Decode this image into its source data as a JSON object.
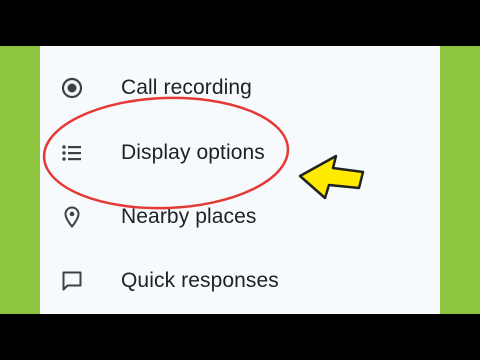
{
  "menu": {
    "items": [
      {
        "label": "Call recording",
        "icon": "radio-target-icon"
      },
      {
        "label": "Display options",
        "icon": "list-icon"
      },
      {
        "label": "Nearby places",
        "icon": "location-pin-icon"
      },
      {
        "label": "Quick responses",
        "icon": "chat-bubble-icon"
      }
    ]
  },
  "colors": {
    "frame_green": "#8ec63f",
    "panel_bg": "#f7fafc",
    "text": "#202124",
    "highlight_circle": "#e53935",
    "pointer_arrow": "#ffeb00"
  }
}
